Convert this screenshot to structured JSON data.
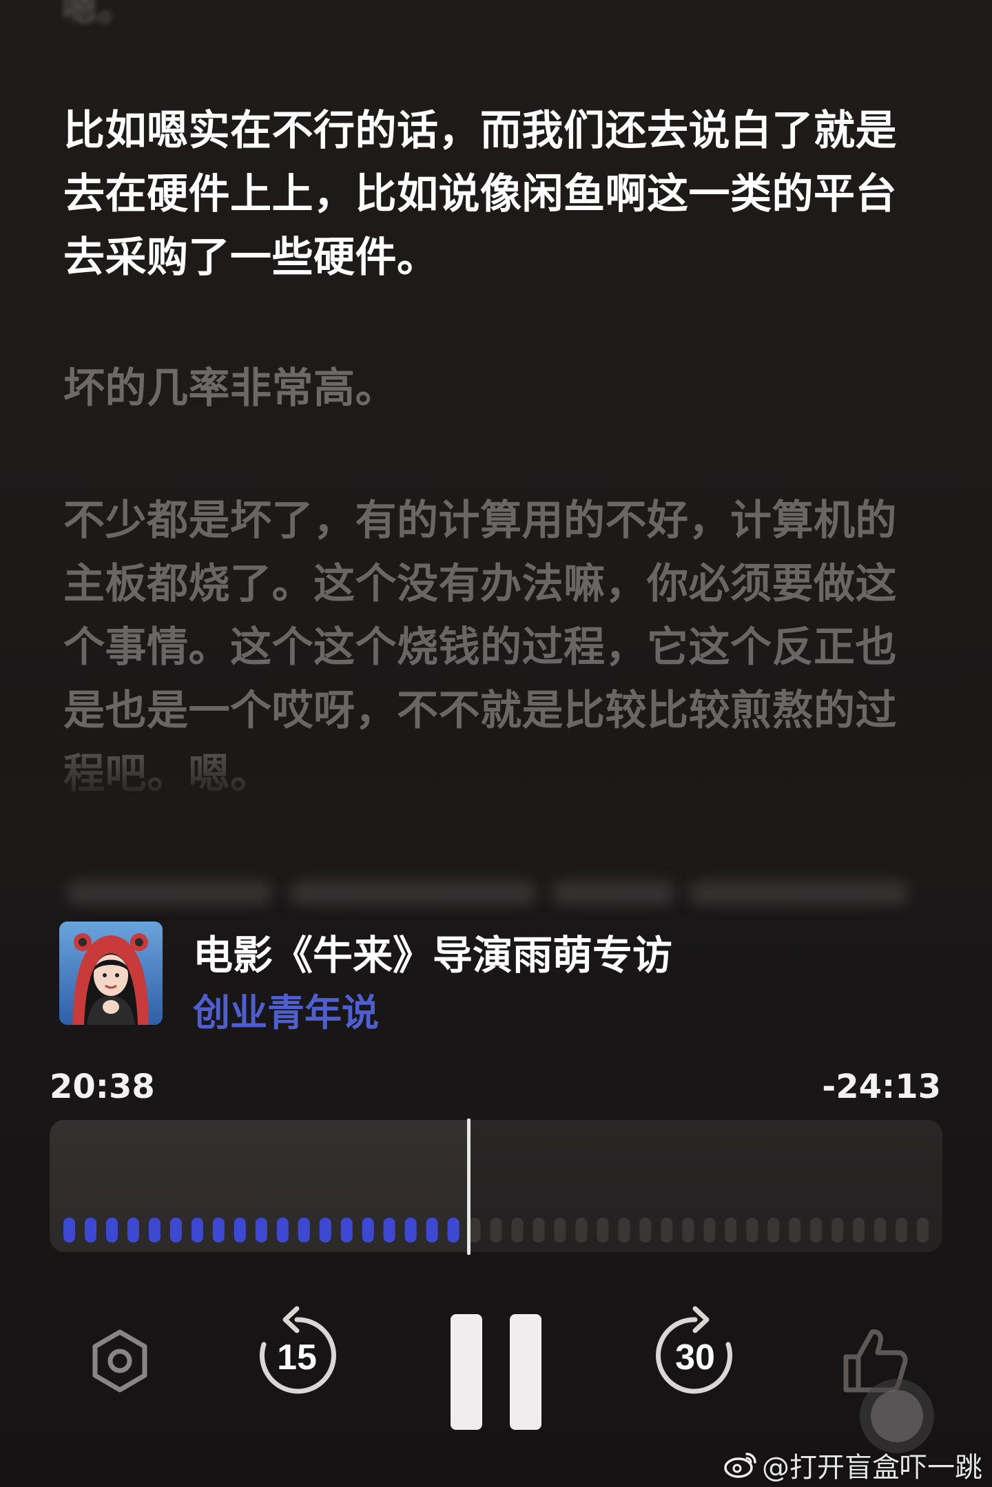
{
  "transcript": {
    "active_line": "比如嗯实在不行的话，而我们还去说白了就是去在硬件上上，比如说像闲鱼啊这一类的平台去采购了一些硬件。",
    "next_line_1": "坏的几率非常高。",
    "next_line_2": "不少都是坏了，有的计算用的不好，计算机的主板都烧了。这个没有办法嘛，你必须要做这个事情。这个这个烧钱的过程，它这个反正也是也是一个哎呀，不不就是比较比较煎熬的过程吧。嗯。"
  },
  "episode": {
    "title": "电影《牛来》导演雨萌专访",
    "show": "创业青年说"
  },
  "player": {
    "elapsed": "20:38",
    "remaining": "-24:13",
    "progress_fraction": 0.459,
    "skip_back_seconds": "15",
    "skip_forward_seconds": "30",
    "state": "playing"
  },
  "colors": {
    "accent": "#4a55d6",
    "show_name": "#4f5fd0",
    "wave_played": "#3d49d2",
    "wave_unplayed": "#3a3636"
  },
  "icons": {
    "settings": "hexagon-gear-icon",
    "skip_back": "rewind-15-icon",
    "play_pause": "pause-icon",
    "skip_forward": "forward-30-icon",
    "like": "thumbs-up-icon"
  },
  "watermark": {
    "text": "@打开盲盒吓一跳"
  }
}
